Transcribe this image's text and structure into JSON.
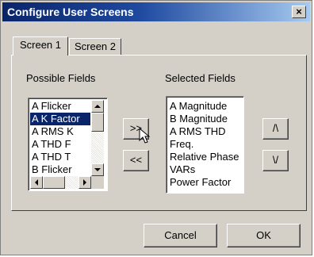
{
  "window": {
    "title": "Configure User Screens",
    "close_glyph": "×"
  },
  "tabs": [
    {
      "label": "Screen 1"
    },
    {
      "label": "Screen 2"
    }
  ],
  "possible_fields": {
    "label": "Possible Fields",
    "items": [
      "A Flicker",
      "A K Factor",
      "A RMS K",
      "A THD F",
      "A THD T",
      "B Flicker"
    ],
    "selected_item": "A K Factor"
  },
  "selected_fields": {
    "label": "Selected Fields",
    "items": [
      "A Magnitude",
      "B Magnitude",
      "A RMS THD",
      "Freq.",
      "Relative Phase",
      "VARs",
      "Power Factor"
    ]
  },
  "buttons": {
    "add": ">>",
    "remove": "<<",
    "move_up": "/\\",
    "move_down": "\\/",
    "cancel": "Cancel",
    "ok": "OK"
  },
  "icons": [
    "close-icon",
    "scroll-up-arrow-icon",
    "scroll-down-arrow-icon",
    "scroll-left-arrow-icon",
    "scroll-right-arrow-icon",
    "mouse-cursor-icon"
  ]
}
